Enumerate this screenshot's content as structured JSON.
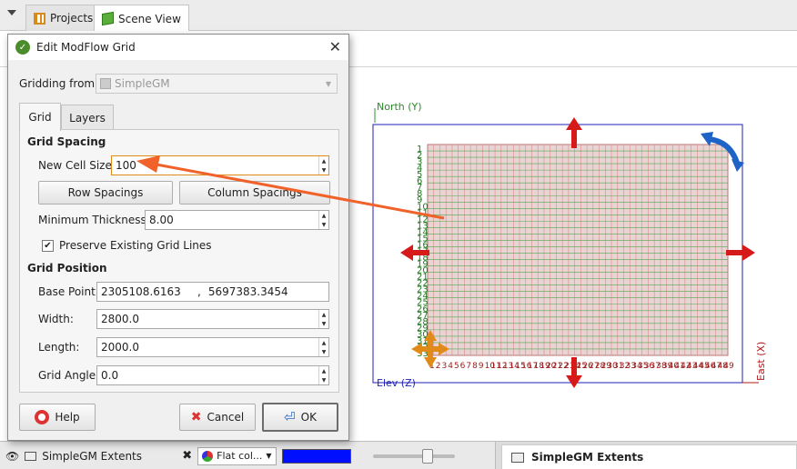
{
  "tabs": [
    {
      "label": "Projects",
      "icon": "grid-icon"
    },
    {
      "label": "Scene View",
      "icon": "cube-icon"
    }
  ],
  "dialog": {
    "title": "Edit ModFlow Grid",
    "gridding_from_label": "Gridding from:",
    "gridding_from_value": "SimpleGM",
    "subtabs": [
      "Grid",
      "Layers"
    ],
    "grid_spacing": {
      "title": "Grid Spacing",
      "new_cell_size_label": "New Cell Size:",
      "new_cell_size_value": "100",
      "row_spacings": "Row Spacings",
      "column_spacings": "Column Spacings",
      "min_thickness_label": "Minimum Thickness:",
      "min_thickness_value": "8.00",
      "preserve_label": "Preserve Existing Grid Lines",
      "preserve_checked": true
    },
    "grid_position": {
      "title": "Grid Position",
      "base_point_label": "Base Point:",
      "base_point_x": "2305108.6163",
      "base_point_sep": ",",
      "base_point_y": "5697383.3454",
      "width_label": "Width:",
      "width_value": "2800.0",
      "length_label": "Length:",
      "length_value": "2000.0",
      "angle_label": "Grid Angle:",
      "angle_value": "0.0"
    },
    "buttons": {
      "help": "Help",
      "cancel": "Cancel",
      "ok": "OK"
    }
  },
  "scene": {
    "axis_north": "North (Y)",
    "axis_east": "East (X)",
    "axis_elev": "Elev (Z)",
    "row_labels": [
      "1",
      "2",
      "3",
      "4",
      "5",
      "6",
      "7",
      "8",
      "9",
      "10",
      "11",
      "12",
      "13",
      "14",
      "15",
      "16",
      "17",
      "18",
      "19",
      "20",
      "21",
      "22",
      "23",
      "24",
      "25",
      "26",
      "27",
      "28",
      "29",
      "30",
      "31",
      "32",
      "33"
    ],
    "col_labels": [
      "1",
      "2",
      "3",
      "4",
      "5",
      "6",
      "7",
      "8",
      "9",
      "10",
      "11",
      "12",
      "13",
      "14",
      "15",
      "16",
      "17",
      "18",
      "19",
      "20",
      "21",
      "22",
      "23",
      "24",
      "25",
      "26",
      "27",
      "28",
      "29",
      "30",
      "31",
      "32",
      "33",
      "34",
      "35",
      "36",
      "37",
      "38",
      "39",
      "40",
      "41",
      "42",
      "43",
      "44",
      "45",
      "46",
      "47",
      "48",
      "49"
    ],
    "colors": {
      "grid_fill": "#e9d4d4",
      "grid_line_v": "#d98a8a",
      "grid_line_h": "#4ea84e",
      "box": "#1f1fb5",
      "arrow": "#d61a1a",
      "rotate": "#1f62c8",
      "move": "#e08a1a",
      "callout": "#f0622a"
    }
  },
  "bottom": {
    "layer_name": "SimpleGM Extents",
    "display_mode": "Flat col...",
    "color": "#0010ff",
    "selected_object": "SimpleGM Extents"
  }
}
